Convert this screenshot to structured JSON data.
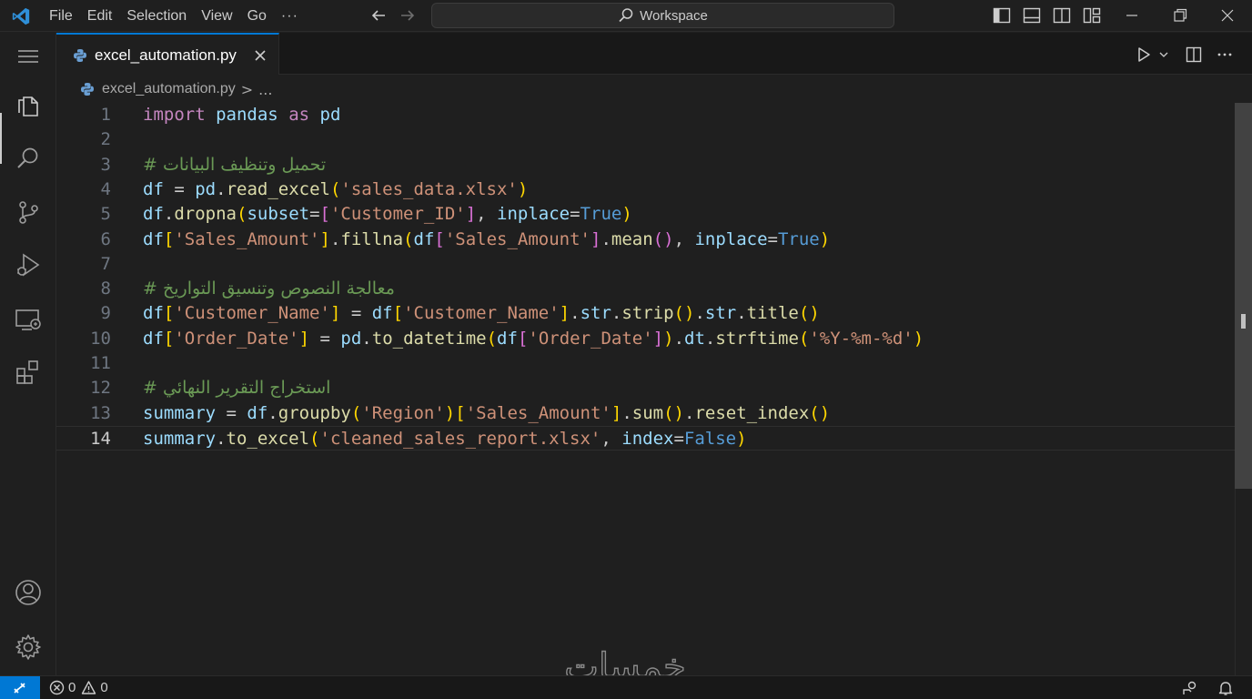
{
  "titlebar": {
    "menu": [
      "File",
      "Edit",
      "Selection",
      "View",
      "Go"
    ],
    "more": "···",
    "search_text": "Workspace"
  },
  "tab": {
    "filename": "excel_automation.py"
  },
  "breadcrumb": {
    "file": "excel_automation.py",
    "separator": ">",
    "more": "..."
  },
  "editor": {
    "current_line": 14,
    "line_numbers": [
      "1",
      "2",
      "3",
      "4",
      "5",
      "6",
      "7",
      "8",
      "9",
      "10",
      "11",
      "12",
      "13",
      "14"
    ],
    "lines": [
      [
        {
          "t": "kw",
          "v": "import"
        },
        {
          "t": "plain",
          "v": " "
        },
        {
          "t": "id",
          "v": "pandas"
        },
        {
          "t": "plain",
          "v": " "
        },
        {
          "t": "kw",
          "v": "as"
        },
        {
          "t": "plain",
          "v": " "
        },
        {
          "t": "id",
          "v": "pd"
        }
      ],
      [],
      [
        {
          "t": "cmt",
          "v": "# تحميل وتنظيف البيانات"
        }
      ],
      [
        {
          "t": "id",
          "v": "df"
        },
        {
          "t": "plain",
          "v": " = "
        },
        {
          "t": "id",
          "v": "pd"
        },
        {
          "t": "plain",
          "v": "."
        },
        {
          "t": "fn",
          "v": "read_excel"
        },
        {
          "t": "b1",
          "v": "("
        },
        {
          "t": "str",
          "v": "'sales_data.xlsx'"
        },
        {
          "t": "b1",
          "v": ")"
        }
      ],
      [
        {
          "t": "id",
          "v": "df"
        },
        {
          "t": "plain",
          "v": "."
        },
        {
          "t": "fn",
          "v": "dropna"
        },
        {
          "t": "b1",
          "v": "("
        },
        {
          "t": "id",
          "v": "subset"
        },
        {
          "t": "plain",
          "v": "="
        },
        {
          "t": "b2",
          "v": "["
        },
        {
          "t": "str",
          "v": "'Customer_ID'"
        },
        {
          "t": "b2",
          "v": "]"
        },
        {
          "t": "plain",
          "v": ", "
        },
        {
          "t": "id",
          "v": "inplace"
        },
        {
          "t": "plain",
          "v": "="
        },
        {
          "t": "bool",
          "v": "True"
        },
        {
          "t": "b1",
          "v": ")"
        }
      ],
      [
        {
          "t": "id",
          "v": "df"
        },
        {
          "t": "b1",
          "v": "["
        },
        {
          "t": "str",
          "v": "'Sales_Amount'"
        },
        {
          "t": "b1",
          "v": "]"
        },
        {
          "t": "plain",
          "v": "."
        },
        {
          "t": "fn",
          "v": "fillna"
        },
        {
          "t": "b1",
          "v": "("
        },
        {
          "t": "id",
          "v": "df"
        },
        {
          "t": "b2",
          "v": "["
        },
        {
          "t": "str",
          "v": "'Sales_Amount'"
        },
        {
          "t": "b2",
          "v": "]"
        },
        {
          "t": "plain",
          "v": "."
        },
        {
          "t": "fn",
          "v": "mean"
        },
        {
          "t": "b2",
          "v": "()"
        },
        {
          "t": "plain",
          "v": ", "
        },
        {
          "t": "id",
          "v": "inplace"
        },
        {
          "t": "plain",
          "v": "="
        },
        {
          "t": "bool",
          "v": "True"
        },
        {
          "t": "b1",
          "v": ")"
        }
      ],
      [],
      [
        {
          "t": "cmt",
          "v": "# معالجة النصوص وتنسيق التواريخ"
        }
      ],
      [
        {
          "t": "id",
          "v": "df"
        },
        {
          "t": "b1",
          "v": "["
        },
        {
          "t": "str",
          "v": "'Customer_Name'"
        },
        {
          "t": "b1",
          "v": "]"
        },
        {
          "t": "plain",
          "v": " = "
        },
        {
          "t": "id",
          "v": "df"
        },
        {
          "t": "b1",
          "v": "["
        },
        {
          "t": "str",
          "v": "'Customer_Name'"
        },
        {
          "t": "b1",
          "v": "]"
        },
        {
          "t": "plain",
          "v": "."
        },
        {
          "t": "id",
          "v": "str"
        },
        {
          "t": "plain",
          "v": "."
        },
        {
          "t": "fn",
          "v": "strip"
        },
        {
          "t": "b1",
          "v": "()"
        },
        {
          "t": "plain",
          "v": "."
        },
        {
          "t": "id",
          "v": "str"
        },
        {
          "t": "plain",
          "v": "."
        },
        {
          "t": "fn",
          "v": "title"
        },
        {
          "t": "b1",
          "v": "()"
        }
      ],
      [
        {
          "t": "id",
          "v": "df"
        },
        {
          "t": "b1",
          "v": "["
        },
        {
          "t": "str",
          "v": "'Order_Date'"
        },
        {
          "t": "b1",
          "v": "]"
        },
        {
          "t": "plain",
          "v": " = "
        },
        {
          "t": "id",
          "v": "pd"
        },
        {
          "t": "plain",
          "v": "."
        },
        {
          "t": "fn",
          "v": "to_datetime"
        },
        {
          "t": "b1",
          "v": "("
        },
        {
          "t": "id",
          "v": "df"
        },
        {
          "t": "b2",
          "v": "["
        },
        {
          "t": "str",
          "v": "'Order_Date'"
        },
        {
          "t": "b2",
          "v": "]"
        },
        {
          "t": "b1",
          "v": ")"
        },
        {
          "t": "plain",
          "v": "."
        },
        {
          "t": "id",
          "v": "dt"
        },
        {
          "t": "plain",
          "v": "."
        },
        {
          "t": "fn",
          "v": "strftime"
        },
        {
          "t": "b1",
          "v": "("
        },
        {
          "t": "str",
          "v": "'%Y-%m-%d'"
        },
        {
          "t": "b1",
          "v": ")"
        }
      ],
      [],
      [
        {
          "t": "cmt",
          "v": "# استخراج التقرير النهائي"
        }
      ],
      [
        {
          "t": "id",
          "v": "summary"
        },
        {
          "t": "plain",
          "v": " = "
        },
        {
          "t": "id",
          "v": "df"
        },
        {
          "t": "plain",
          "v": "."
        },
        {
          "t": "fn",
          "v": "groupby"
        },
        {
          "t": "b1",
          "v": "("
        },
        {
          "t": "str",
          "v": "'Region'"
        },
        {
          "t": "b1",
          "v": ")"
        },
        {
          "t": "b1",
          "v": "["
        },
        {
          "t": "str",
          "v": "'Sales_Amount'"
        },
        {
          "t": "b1",
          "v": "]"
        },
        {
          "t": "plain",
          "v": "."
        },
        {
          "t": "fn",
          "v": "sum"
        },
        {
          "t": "b1",
          "v": "()"
        },
        {
          "t": "plain",
          "v": "."
        },
        {
          "t": "fn",
          "v": "reset_index"
        },
        {
          "t": "b1",
          "v": "()"
        }
      ],
      [
        {
          "t": "id",
          "v": "summary"
        },
        {
          "t": "plain",
          "v": "."
        },
        {
          "t": "fn",
          "v": "to_excel"
        },
        {
          "t": "b1",
          "v": "("
        },
        {
          "t": "str",
          "v": "'cleaned_sales_report.xlsx'"
        },
        {
          "t": "plain",
          "v": ", "
        },
        {
          "t": "id",
          "v": "index"
        },
        {
          "t": "plain",
          "v": "="
        },
        {
          "t": "bool",
          "v": "False"
        },
        {
          "t": "b1",
          "v": ")"
        }
      ]
    ]
  },
  "statusbar": {
    "errors": "0",
    "warnings": "0"
  },
  "watermark": {
    "text": "خمسات"
  },
  "colors": {
    "accent": "#0078d4",
    "background": "#1f1f1f",
    "keyword": "#c586c0",
    "string": "#ce9178",
    "comment": "#6a9955",
    "function": "#dcdcaa",
    "variable": "#9cdcfe",
    "boolean": "#569cd6"
  },
  "icons": [
    "vscode-logo",
    "back-arrow-icon",
    "forward-arrow-icon",
    "search-icon",
    "toggle-primary-sidebar-icon",
    "toggle-panel-icon",
    "toggle-secondary-sidebar-icon",
    "customize-layout-icon",
    "minimize-icon",
    "restore-icon",
    "close-icon",
    "menu-icon",
    "explorer-icon",
    "search-icon",
    "source-control-icon",
    "run-debug-icon",
    "remote-explorer-icon",
    "extensions-icon",
    "accounts-icon",
    "settings-gear-icon",
    "python-file-icon",
    "run-icon",
    "split-editor-icon",
    "more-actions-icon",
    "remote-icon",
    "error-icon",
    "warning-icon",
    "feedback-icon",
    "bell-icon"
  ]
}
